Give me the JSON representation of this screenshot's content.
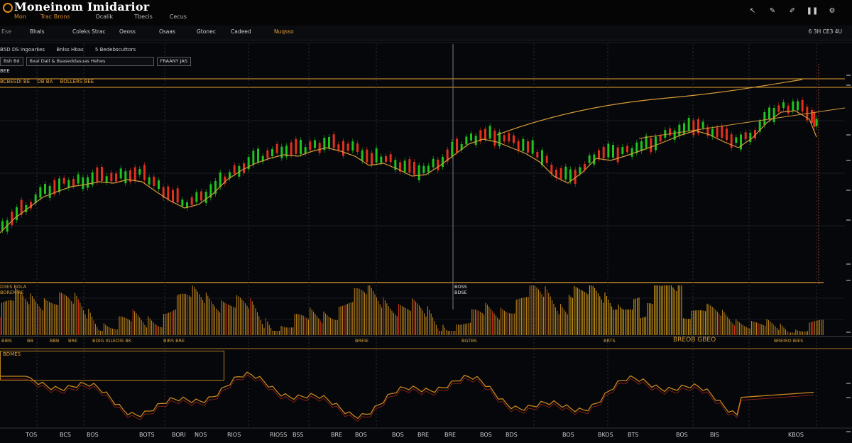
{
  "app": {
    "title": "Moneinom Imidarior",
    "menu": [
      "Mon",
      "Trac Brons",
      "Ocalik",
      "Tbecis",
      "Cecus"
    ],
    "links": []
  },
  "toolbar": {
    "left": "Ese",
    "tabs": [
      "Bhals",
      "Coleks Strac",
      "Oeoss",
      "Osaas",
      "Gtonec",
      "Cadeed",
      "Nuqsso"
    ],
    "selected_index": 6,
    "right": "6 3H CE3 4U"
  },
  "info": {
    "row1": [
      "B5D DS Ingoarkes",
      "Bnlss Hbas",
      "5 Bedebscuttors"
    ],
    "row2": [
      "Bsh Bd",
      "Bxal Dall & Bsaseddasuas Hehes",
      "FRAANY JAS"
    ],
    "row3": "BEE",
    "header_strip": [
      "BCBESDI BE",
      "DB BA",
      "BOLLERS BEE"
    ]
  },
  "volume": {
    "label_lines": [
      "D3ES BOLA",
      "BDRENIRE"
    ],
    "tag_lines": [
      "BOSS",
      "BDSE"
    ]
  },
  "oscillator": {
    "header": [
      "BIBS",
      "BB",
      "BBB",
      "BRE",
      "BDIG IGLEOIS BK",
      "BIRS BRE",
      "BREIE",
      "BGTBS",
      "BRTS",
      "BREOB GBEO",
      "BREIRO BIES"
    ],
    "title": "BDMES"
  },
  "xaxis": {
    "labels": [
      "TOS",
      "BCS",
      "BOS",
      "BOTS",
      "BORI",
      "NOS",
      "RIOS",
      "RIOSS",
      "BSS",
      "BRE",
      "BOS",
      "BOS",
      "BRE",
      "BRE",
      "BOS",
      "BDS",
      "BOS",
      "BKOS",
      "BTS",
      "BOS",
      "BIS",
      "KBOS"
    ]
  },
  "colors": {
    "background": "#06070b",
    "bull": "#1fc21f",
    "bear": "#e0311d",
    "accent": "#e4a032",
    "ma": "#d59a3a"
  },
  "icons": {
    "top_right": [
      "cursor-icon",
      "pen-icon",
      "brush-icon",
      "pause-icon",
      "gear-icon"
    ]
  },
  "chart_data": {
    "type": "candlestick",
    "title": "",
    "series": [
      {
        "name": "",
        "values": []
      }
    ]
  }
}
